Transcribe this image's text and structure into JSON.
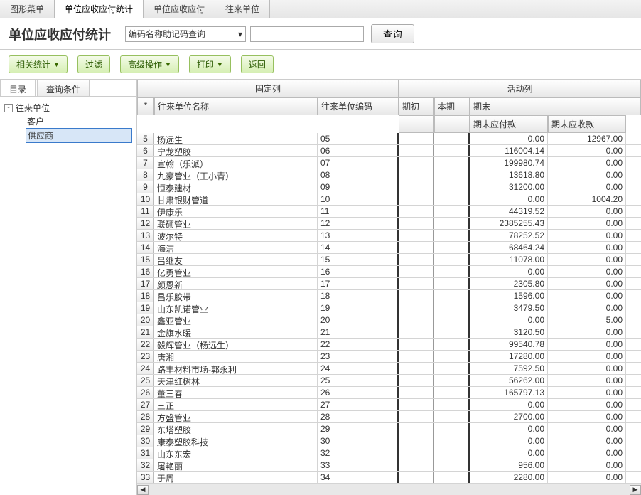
{
  "tabs": {
    "t0": "图形菜单",
    "t1": "单位应收应付统计",
    "t2": "单位应收应付",
    "t3": "往来单位"
  },
  "title": "单位应收应付统计",
  "search": {
    "placeholder": "编码名称助记码查询",
    "btn": "查询"
  },
  "toolbar": {
    "xgtj": "相关统计",
    "gl": "过滤",
    "gjcz": "高级操作",
    "dy": "打印",
    "fh": "返回"
  },
  "lpTabs": {
    "ml": "目录",
    "cxtj": "查询条件"
  },
  "tree": {
    "root": "往来单位",
    "c1": "客户",
    "c2": "供应商"
  },
  "gridHead": {
    "fixed": "固定列",
    "active": "活动列",
    "mark": "*",
    "name": "往来单位名称",
    "code": "往来单位编码",
    "qc": "期初",
    "bq": "本期",
    "qm": "期末",
    "pay": "期末应付款",
    "recv": "期末应收款"
  },
  "chart_data": {
    "type": "table",
    "columns": [
      "row",
      "name",
      "code",
      "pay",
      "recv"
    ],
    "rows": [
      {
        "row": 5,
        "name": "杨远生",
        "code": "05",
        "pay": "0.00",
        "recv": "12967.00"
      },
      {
        "row": 6,
        "name": "宁龙塑胶",
        "code": "06",
        "pay": "116004.14",
        "recv": "0.00"
      },
      {
        "row": 7,
        "name": "宣翰（乐派）",
        "code": "07",
        "pay": "199980.74",
        "recv": "0.00"
      },
      {
        "row": 8,
        "name": "九豪管业（王小青）",
        "code": "08",
        "pay": "13618.80",
        "recv": "0.00"
      },
      {
        "row": 9,
        "name": "恒泰建材",
        "code": "09",
        "pay": "31200.00",
        "recv": "0.00"
      },
      {
        "row": 10,
        "name": "甘肃银财管道",
        "code": "10",
        "pay": "0.00",
        "recv": "1004.20"
      },
      {
        "row": 11,
        "name": "伊康乐",
        "code": "11",
        "pay": "44319.52",
        "recv": "0.00"
      },
      {
        "row": 12,
        "name": "联硕管业",
        "code": "12",
        "pay": "2385255.43",
        "recv": "0.00"
      },
      {
        "row": 13,
        "name": "波尔特",
        "code": "13",
        "pay": "78252.52",
        "recv": "0.00"
      },
      {
        "row": 14,
        "name": "海洁",
        "code": "14",
        "pay": "68464.24",
        "recv": "0.00"
      },
      {
        "row": 15,
        "name": "吕继友",
        "code": "15",
        "pay": "11078.00",
        "recv": "0.00"
      },
      {
        "row": 16,
        "name": "亿勇管业",
        "code": "16",
        "pay": "0.00",
        "recv": "0.00"
      },
      {
        "row": 17,
        "name": "颜恩新",
        "code": "17",
        "pay": "2305.80",
        "recv": "0.00"
      },
      {
        "row": 18,
        "name": "昌乐胶带",
        "code": "18",
        "pay": "1596.00",
        "recv": "0.00"
      },
      {
        "row": 19,
        "name": "山东凯诺管业",
        "code": "19",
        "pay": "3479.50",
        "recv": "0.00"
      },
      {
        "row": 20,
        "name": "鑫亚管业",
        "code": "20",
        "pay": "0.00",
        "recv": "5.00"
      },
      {
        "row": 21,
        "name": "金旗水暖",
        "code": "21",
        "pay": "3120.50",
        "recv": "0.00"
      },
      {
        "row": 22,
        "name": "毅辉管业（杨远生）",
        "code": "22",
        "pay": "99540.78",
        "recv": "0.00"
      },
      {
        "row": 23,
        "name": "唐湘",
        "code": "23",
        "pay": "17280.00",
        "recv": "0.00"
      },
      {
        "row": 24,
        "name": "路丰材料市场-郭永利",
        "code": "24",
        "pay": "7592.50",
        "recv": "0.00"
      },
      {
        "row": 25,
        "name": "天津红树林",
        "code": "25",
        "pay": "56262.00",
        "recv": "0.00"
      },
      {
        "row": 26,
        "name": "董三春",
        "code": "26",
        "pay": "165797.13",
        "recv": "0.00"
      },
      {
        "row": 27,
        "name": "三正",
        "code": "27",
        "pay": "0.00",
        "recv": "0.00"
      },
      {
        "row": 28,
        "name": "方盛管业",
        "code": "28",
        "pay": "2700.00",
        "recv": "0.00"
      },
      {
        "row": 29,
        "name": "东塔塑胶",
        "code": "29",
        "pay": "0.00",
        "recv": "0.00"
      },
      {
        "row": 30,
        "name": "康泰塑胶科技",
        "code": "30",
        "pay": "0.00",
        "recv": "0.00"
      },
      {
        "row": 31,
        "name": "山东东宏",
        "code": "32",
        "pay": "0.00",
        "recv": "0.00"
      },
      {
        "row": 32,
        "name": "屠艳丽",
        "code": "33",
        "pay": "956.00",
        "recv": "0.00"
      },
      {
        "row": 33,
        "name": "于周",
        "code": "34",
        "pay": "2280.00",
        "recv": "0.00"
      }
    ]
  }
}
